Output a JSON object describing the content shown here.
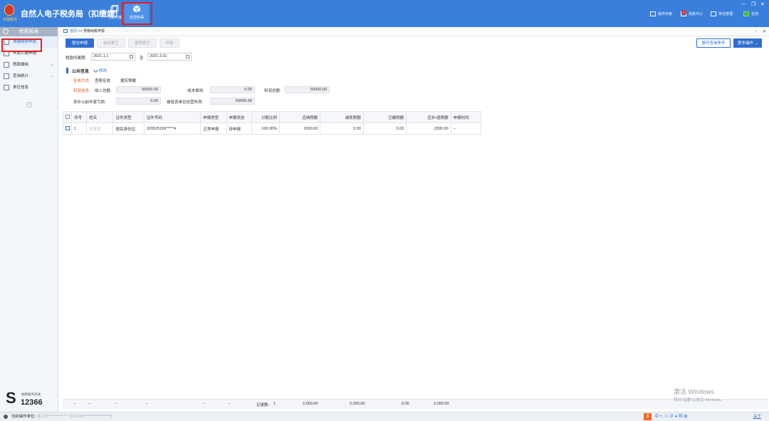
{
  "app": {
    "title": "自然人电子税务局（扣缴端）",
    "logo_text": "中国税务"
  },
  "top_nav": [
    {
      "label": "代扣代缴"
    },
    {
      "label": "经营所得"
    }
  ],
  "top_right": {
    "manual": "操作手册",
    "messages": "消息中心",
    "messages_badge": "1",
    "unit_mgmt": "单位管理",
    "online": "在线"
  },
  "sidebar": {
    "header": "税费报表",
    "items": [
      {
        "label": "预缴纳税申报"
      },
      {
        "label": "年度汇缴申报"
      },
      {
        "label": "税款缴纳"
      },
      {
        "label": "查询统计"
      },
      {
        "label": "单位信息"
      }
    ],
    "collapse": "«",
    "hotline_caption": "纳税服务热线",
    "hotline_number": "12366"
  },
  "breadcrumb": {
    "home": "首页",
    "sep": ">>",
    "current": "预缴纳税申报"
  },
  "toolbar": {
    "submit": "提交申报",
    "start_correction": "启动更正",
    "cancel_correction": "撤销更正",
    "void": "作废",
    "expand_query": "展开查询条件",
    "more": "更多操作"
  },
  "period": {
    "label": "税款所属期:",
    "from": "2021.1.1",
    "to_label": "至",
    "to": "2021.3.31"
  },
  "public_info": {
    "title": "公共信息",
    "edit": "修改",
    "method_label": "征收方式:",
    "method_value": "查账征收",
    "method_sub": "据实预缴",
    "profit_label": "利润信息:",
    "income_label": "收入总额:",
    "income_value": "50000.00",
    "cost_label": "成本费用:",
    "cost_value": "0.00",
    "profit_total_label": "利润总额:",
    "profit_total_value": "50000.00",
    "loss_label": "弥补以前年度亏损:",
    "loss_value": "0.00",
    "invested_label": "被投资单位经营所得:",
    "invested_value": "50000.00"
  },
  "table": {
    "columns": [
      "序号",
      "姓名",
      "证件类型",
      "证件号码",
      "申报类型",
      "申报状态",
      "分配比例",
      "应纳税额",
      "减免税额",
      "已缴税额",
      "应补/退税额",
      "申报时间"
    ],
    "rows": [
      [
        "1",
        "郑某某",
        "居民身份证",
        "320525199*****4",
        "正常申报",
        "待申报",
        "100.00%",
        "2000.00",
        "0.00",
        "0.00",
        "2000.00",
        "--"
      ]
    ]
  },
  "footer": {
    "dashes": "--",
    "record_label": "记录数:",
    "record_count": "1",
    "sum_percent": "2,000.00",
    "tax_due": "2,000.00",
    "reduction": "0.00",
    "paid": "0.00",
    "refund": "2,000.00"
  },
  "status_bar": {
    "operator_label": "当前操作单位:",
    "operator_value": "吴江市*************",
    "taxid": "[913205******************]",
    "about": "关于"
  },
  "watermark": {
    "line1": "激活 Windows",
    "line2": "转到\"设置\"以激活 Windows。"
  },
  "colors": {
    "brand": "#3a7fdc",
    "primary": "#2f6fd0",
    "highlight_box": "#e02020"
  }
}
